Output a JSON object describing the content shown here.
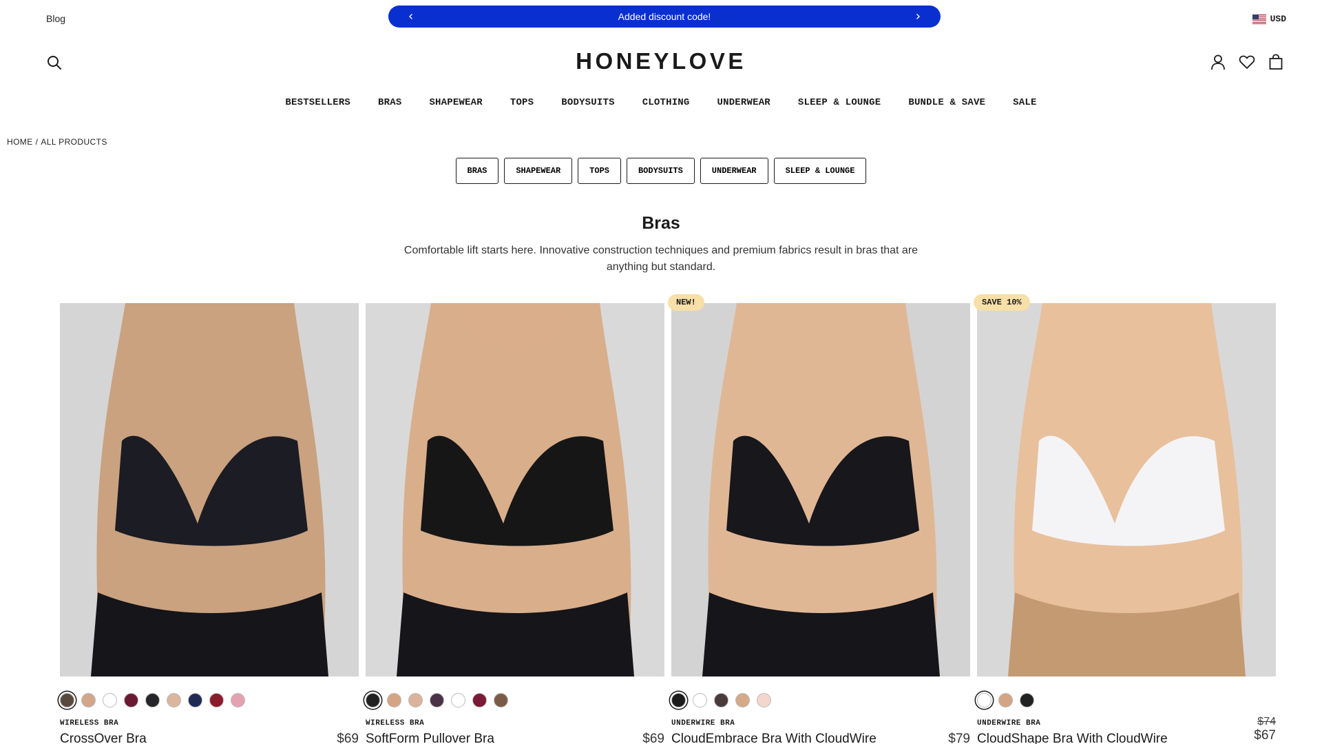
{
  "topbar": {
    "blog_label": "Blog",
    "announcement": "Added discount code!",
    "currency": "USD"
  },
  "header": {
    "logo": "HONEYLOVE"
  },
  "nav": {
    "items": [
      {
        "label": "BESTSELLERS"
      },
      {
        "label": "BRAS"
      },
      {
        "label": "SHAPEWEAR"
      },
      {
        "label": "TOPS"
      },
      {
        "label": "BODYSUITS"
      },
      {
        "label": "CLOTHING"
      },
      {
        "label": "UNDERWEAR"
      },
      {
        "label": "SLEEP & LOUNGE"
      },
      {
        "label": "BUNDLE & SAVE"
      },
      {
        "label": "SALE"
      }
    ]
  },
  "breadcrumb": {
    "home": "HOME",
    "separator": "/",
    "current": "ALL PRODUCTS"
  },
  "pills": [
    {
      "label": "BRAS"
    },
    {
      "label": "SHAPEWEAR"
    },
    {
      "label": "TOPS"
    },
    {
      "label": "BODYSUITS"
    },
    {
      "label": "UNDERWEAR"
    },
    {
      "label": "SLEEP & LOUNGE"
    }
  ],
  "category": {
    "title": "Bras",
    "description": "Comfortable lift starts here. Innovative construction techniques and premium fabrics result in bras that are anything but standard."
  },
  "products": [
    {
      "type": "WIRELESS BRA",
      "name": "CrossOver Bra",
      "price": "$69",
      "badge": "",
      "image_bg": "#d5d5d5",
      "skin": "#caa27f",
      "garment": "#1c1c24",
      "swatches": [
        "#5a4a3e",
        "#d1a68a",
        "#ffffff",
        "#6a1a30",
        "#25252a",
        "#dbb59d",
        "#1f2a55",
        "#8a1c2c",
        "#e4a2b0"
      ]
    },
    {
      "type": "WIRELESS BRA",
      "name": "SoftForm Pullover Bra",
      "price": "$69",
      "badge": "",
      "image_bg": "#d9d9d9",
      "skin": "#d9ae8b",
      "garment": "#161616",
      "swatches": [
        "#222222",
        "#d4a585",
        "#dbb29b",
        "#4a3346",
        "#ffffff",
        "#7a1a34",
        "#7a5b48"
      ]
    },
    {
      "type": "UNDERWIRE BRA",
      "name": "CloudEmbrace Bra With CloudWire",
      "price": "$79",
      "badge": "NEW!",
      "image_bg": "#d3d3d3",
      "skin": "#e0b795",
      "garment": "#17171c",
      "swatches": [
        "#1c1c1c",
        "#ffffff",
        "#4a3a3a",
        "#d4aa88",
        "#f4d6cf"
      ]
    },
    {
      "type": "UNDERWIRE BRA",
      "name": "CloudShape Bra With CloudWire",
      "price": "$67",
      "price_old": "$74",
      "badge": "SAVE 10%",
      "image_bg": "#d8d8d8",
      "skin": "#e8c09c",
      "garment": "#f4f4f7",
      "swatches": [
        "#ffffff",
        "#d4a585",
        "#222222"
      ]
    }
  ]
}
